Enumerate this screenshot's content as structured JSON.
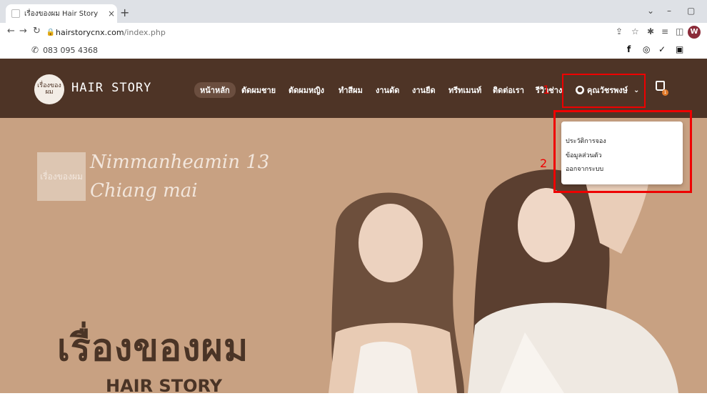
{
  "browser": {
    "tab_title": "เรื่องของผม Hair Story",
    "tab_close": "×",
    "new_tab": "+",
    "url_host": "hairstorycnx.com",
    "url_path": "/index.php",
    "profile_initial": "W"
  },
  "site": {
    "phone": "083 095 4368",
    "logo_text": "เรื่องของผม",
    "brand": "HAIR STORY",
    "nav": [
      "หน้าหลัก",
      "ตัดผมชาย",
      "ตัดผมหญิง",
      "ทำสีผม",
      "งานดัด",
      "งานยืด",
      "ทรีทเมนท์",
      "ติดต่อเรา",
      "รีวิวช่าง"
    ],
    "user_label": "คุณวัชรพงษ์",
    "cart_count": "1",
    "annotation_1": "1",
    "annotation_2": "2",
    "dropdown": [
      "ประวัติการจอง",
      "ข้อมูลส่วนตัว",
      "ออกจากระบบ"
    ]
  },
  "hero": {
    "logo_text": "เรื่องของผม",
    "script_line1": "Nimmanheamin 13",
    "script_line2": "Chiang mai",
    "title_th": "เรื่องของผม",
    "title_en": "HAIR STORY"
  },
  "colors": {
    "nav_bg": "#4e3426",
    "hero_bg": "#c8a182",
    "annotation_red": "#e00000"
  }
}
